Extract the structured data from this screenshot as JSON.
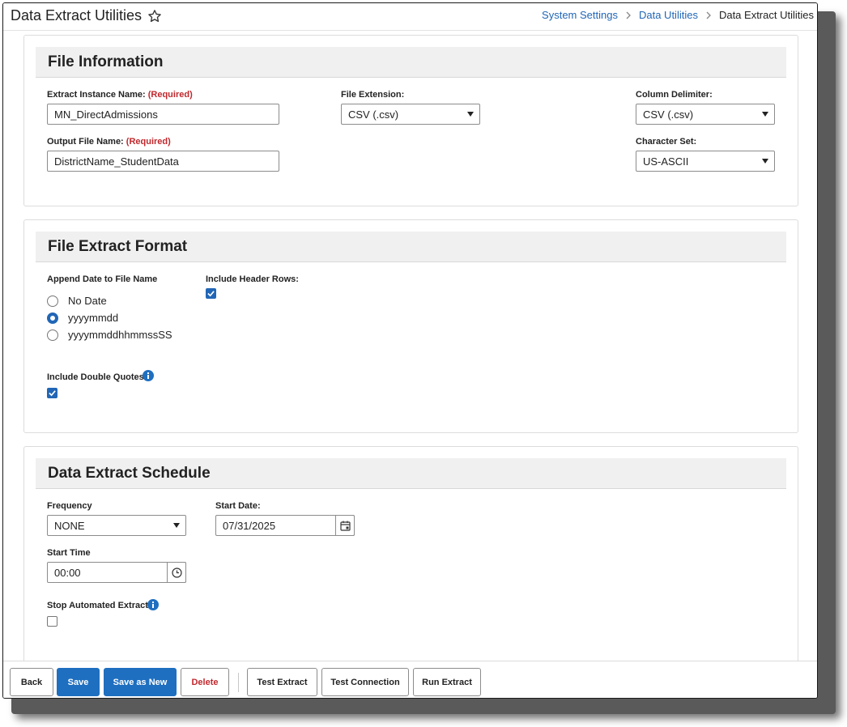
{
  "header": {
    "title": "Data Extract Utilities",
    "breadcrumb": [
      {
        "label": "System Settings",
        "link": true
      },
      {
        "label": "Data Utilities",
        "link": true
      },
      {
        "label": "Data Extract Utilities",
        "link": false
      }
    ]
  },
  "file_information": {
    "title": "File Information",
    "instance_name_label": "Extract Instance Name:",
    "instance_name_required": "(Required)",
    "instance_name_value": "MN_DirectAdmissions",
    "output_name_label": "Output File Name:",
    "output_name_required": "(Required)",
    "output_name_value": "DistrictName_StudentData",
    "file_extension_label": "File Extension:",
    "file_extension_value": "CSV (.csv)",
    "column_delimiter_label": "Column Delimiter:",
    "column_delimiter_value": "CSV (.csv)",
    "character_set_label": "Character Set:",
    "character_set_value": "US-ASCII"
  },
  "file_extract_format": {
    "title": "File Extract Format",
    "append_date_label": "Append Date to File Name",
    "append_date_options": [
      "No Date",
      "yyyymmdd",
      "yyyymmddhhmmssSS"
    ],
    "append_date_selected": "yyyymmdd",
    "include_header_label": "Include Header Rows:",
    "include_header_checked": true,
    "include_quotes_label": "Include Double Quotes:",
    "include_quotes_checked": true
  },
  "schedule": {
    "title": "Data Extract Schedule",
    "frequency_label": "Frequency",
    "frequency_value": "NONE",
    "start_date_label": "Start Date:",
    "start_date_value": "07/31/2025",
    "start_time_label": "Start Time",
    "start_time_value": "00:00",
    "stop_label": "Stop Automated Extract:",
    "stop_checked": false
  },
  "footer": {
    "back": "Back",
    "save": "Save",
    "save_as_new": "Save as New",
    "delete": "Delete",
    "test_extract": "Test Extract",
    "test_connection": "Test Connection",
    "run_extract": "Run Extract"
  },
  "colors": {
    "primary": "#1f6fc0",
    "link": "#2166b6",
    "required": "#c0282d",
    "section_header_bg": "#f0f0f0"
  }
}
